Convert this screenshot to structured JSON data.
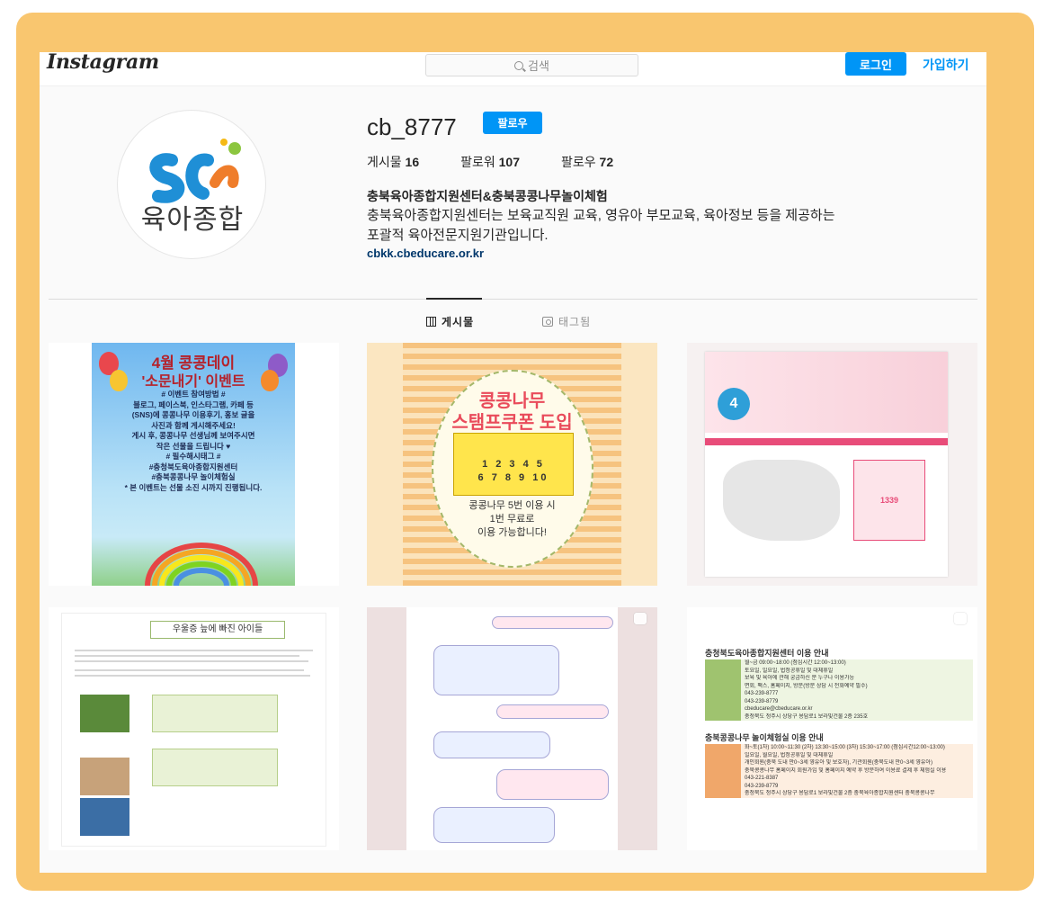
{
  "header": {
    "logo": "Instagram",
    "search_placeholder": "검색",
    "login_label": "로그인",
    "signup_label": "가입하기"
  },
  "profile": {
    "avatar_text": "육아종합",
    "username": "cb_8777",
    "follow_label": "팔로우",
    "stats": {
      "posts_label": "게시물",
      "posts_count": "16",
      "followers_label": "팔로워",
      "followers_count": "107",
      "following_label": "팔로우",
      "following_count": "72"
    },
    "full_name": "충북육아종합지원센터&충북콩콩나무놀이체험",
    "bio_line1": "충북육아종합지원센터는 보육교직원 교육, 영유아 부모교육, 육아정보 등을 제공하는",
    "bio_line2": "포괄적 육아전문지원기관입니다.",
    "website": "cbkk.cbeducare.or.kr"
  },
  "tabs": {
    "posts": "게시물",
    "tagged": "태그됨"
  },
  "posts": {
    "p1": {
      "title1": "4월 콩콩데이",
      "title2": "'소문내기' 이벤트",
      "body": "# 이벤트 참여방법 #\n블로그, 페이스북, 인스타그램, 카페 등\n(SNS)에 콩콩나무 이용후기, 홍보 글을\n사진과 함께 게시해주세요!\n게시 후, 콩콩나무 선생님께 보여주시면\n작은 선물을 드립니다 ♥\n# 필수해시태그 #\n#충청북도육아종합지원센터\n#충북콩콩나무 놀이체험실\n* 본 이벤트는 선물 소진 시까지 진행됩니다."
    },
    "p2": {
      "title1": "콩콩나무",
      "title2": "스탬프쿠폰 도입",
      "nums_row1": "1 2 3 4 5",
      "nums_row2": "6 7 8 9 10",
      "text": "콩콩나무 5번 이용 시\n1번 무료로\n이용 가능합니다!"
    },
    "p3": {
      "badge": "4",
      "fee": "1339"
    },
    "p4": {
      "title": "우울증 늪에 빠진 아이들"
    },
    "p6": {
      "heading1": "충청북도육아종합지원센터 이용 안내",
      "heading2": "충북콩콩나무 놀이체험실 이용 안내",
      "rows1": [
        "월~금 09:00~18:00 (점심시간 12:00~13:00)",
        "토요일, 일요일, 법정공휴일 및 대체휴일",
        "보육 및 육아에 관해 궁금하신 분 누구나 이용가능",
        "면회, 팩스, 홈페이지, 방문(방문 상담 시 전화예약 필수)",
        "043-239-8777",
        "043-239-8779",
        "cbeducare@cbeducare.or.kr",
        "충청북도 청주시 상당구 용담로1 보라빛건물 2층 235호"
      ],
      "rows2": [
        "화~토(1차) 10:00~11:30 (2차) 13:30~15:00 (3차) 15:30~17:00 (점심시간12:00~13:00)",
        "일요일, 월요일, 법정공휴일 및 대체휴일",
        "개인회원(충북 도내 만0~3세 영유아 및 보호자), 기관회원(충북도내 만0~3세 영유아)",
        "충북콩콩나무 홈페이지 회원가입 및 홈페이지 예약 후 방문하여 이용료 결제 후 체험실 이용",
        "043-221-8387",
        "043-239-8779",
        "충청북도 청주시 상당구 용담로1 보라빛건물 2층 충북육아종합지원센터 충북콩콩나무"
      ]
    }
  },
  "colors": {
    "accent": "#0095f6",
    "frame": "#f9c66f",
    "p6_green": "#9fc36f",
    "p6_orange": "#f0a76a"
  }
}
